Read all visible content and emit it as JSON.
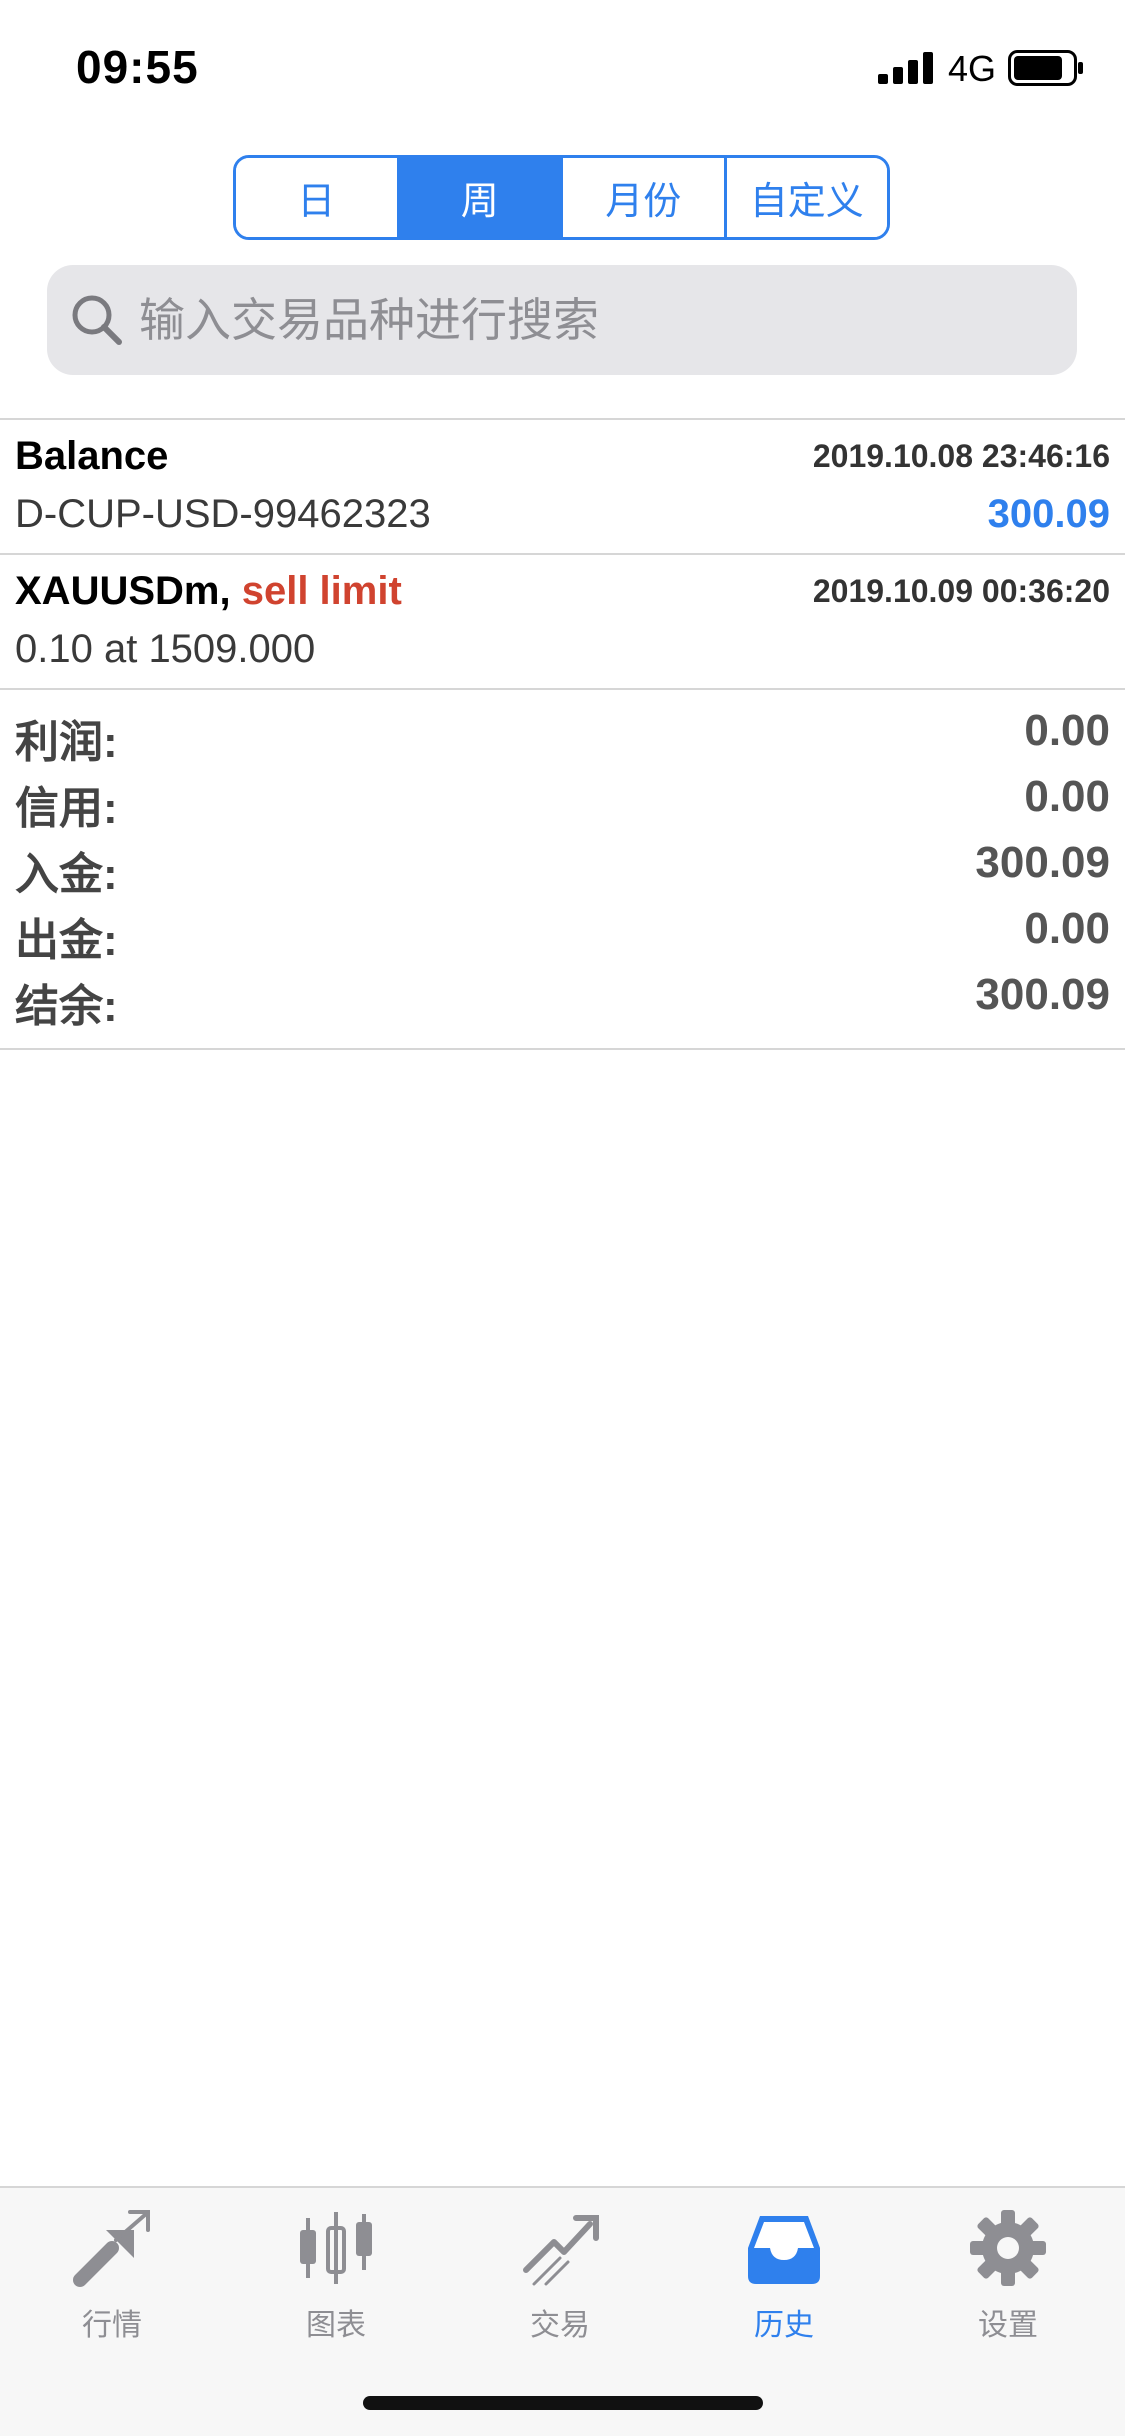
{
  "status_bar": {
    "time": "09:55",
    "network": "4G"
  },
  "segmented": {
    "tabs": [
      "日",
      "周",
      "月份",
      "自定义"
    ],
    "active_index": 1
  },
  "search": {
    "placeholder": "输入交易品种进行搜索"
  },
  "history": [
    {
      "title": "Balance",
      "timestamp": "2019.10.08 23:46:16",
      "subtitle": "D-CUP-USD-99462323",
      "value": "300.09"
    },
    {
      "symbol": "XAUUSDm,",
      "order_type": "sell limit",
      "timestamp": "2019.10.09 00:36:20",
      "subtitle": "0.10 at 1509.000"
    }
  ],
  "summary": {
    "profit": {
      "label": "利润:",
      "value": "0.00"
    },
    "credit": {
      "label": "信用:",
      "value": "0.00"
    },
    "deposit": {
      "label": "入金:",
      "value": "300.09"
    },
    "withdrawal": {
      "label": "出金:",
      "value": "0.00"
    },
    "balance": {
      "label": "结余:",
      "value": "300.09"
    }
  },
  "tabbar": {
    "tabs": [
      {
        "label": "行情",
        "icon": "quotes-icon"
      },
      {
        "label": "图表",
        "icon": "chart-icon"
      },
      {
        "label": "交易",
        "icon": "trade-icon"
      },
      {
        "label": "历史",
        "icon": "history-icon"
      },
      {
        "label": "设置",
        "icon": "settings-icon"
      }
    ],
    "active_index": 3
  },
  "colors": {
    "accent": "#2f80ed",
    "sell": "#d0432f"
  }
}
